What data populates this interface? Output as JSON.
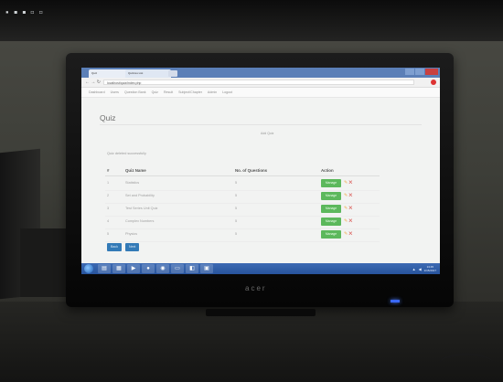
{
  "browser": {
    "tabs": [
      {
        "label": "Quiz"
      },
      {
        "label": "Quizzes List"
      }
    ],
    "url": "localhost/quiz/index.php"
  },
  "app_nav": {
    "items": [
      "Dashboard",
      "Users",
      "Question Bank",
      "Quiz",
      "Result",
      "Subject/Chapter",
      "Admin",
      "Logout"
    ]
  },
  "page": {
    "title": "Quiz",
    "center_link": "Add Quiz",
    "success_message": "Quiz deleted successfully"
  },
  "table": {
    "headers": [
      "#",
      "Quiz Name",
      "No. of Questions",
      "Action"
    ],
    "rows": [
      {
        "num": "1",
        "name": "Statistics",
        "count": "5"
      },
      {
        "num": "2",
        "name": "Set and Probability",
        "count": "5"
      },
      {
        "num": "3",
        "name": "Test Series Unit Quiz",
        "count": "5"
      },
      {
        "num": "4",
        "name": "Complex Numbers",
        "count": "5"
      },
      {
        "num": "5",
        "name": "Physics",
        "count": "5"
      }
    ],
    "manage_label": "Manage"
  },
  "actions": {
    "back": "Back",
    "next": "Next"
  },
  "taskbar": {
    "time": "13:45",
    "date": "1/15/2017"
  },
  "monitor": {
    "brand": "acer",
    "background_text": "▪ ◼ ◼ ◻ ◻"
  },
  "colors": {
    "manage": "#5cb85c",
    "delete": "#d9534f",
    "primary": "#337ab7",
    "tab_strip": "#5b7fb7"
  }
}
